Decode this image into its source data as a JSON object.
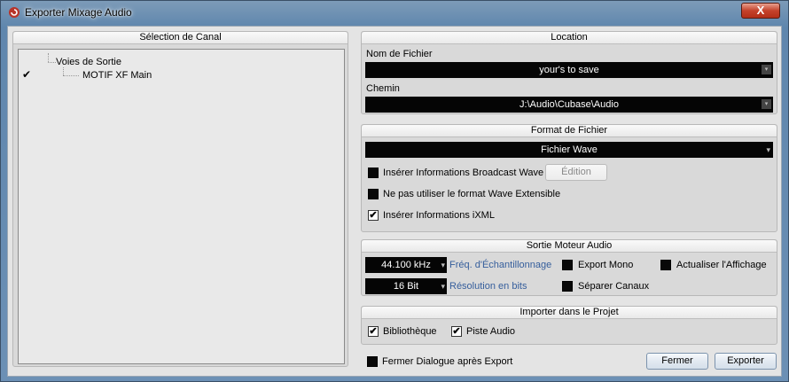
{
  "window": {
    "title": "Exporter Mixage Audio",
    "close_glyph": "X"
  },
  "channel_selection": {
    "header": "Sélection de Canal",
    "tree_root": "Voies de Sortie",
    "tree_child": "MOTIF XF Main",
    "child_checked": true
  },
  "location": {
    "header": "Location",
    "filename_label": "Nom de Fichier",
    "filename_value": "your's to save",
    "path_label": "Chemin",
    "path_value": "J:\\Audio\\Cubase\\Audio"
  },
  "file_format": {
    "header": "Format de Fichier",
    "format_value": "Fichier Wave",
    "broadcast_label": "Insérer Informations Broadcast Wave",
    "broadcast_checked": false,
    "edit_button": "Édition",
    "no_extensible_label": "Ne pas utiliser le format Wave Extensible",
    "no_extensible_checked": false,
    "ixml_label": "Insérer Informations iXML",
    "ixml_checked": true
  },
  "audio_engine": {
    "header": "Sortie Moteur Audio",
    "sample_rate_value": "44.100 kHz",
    "sample_rate_label": "Fréq. d'Échantillonnage",
    "bit_depth_value": "16 Bit",
    "bit_depth_label": "Résolution en bits",
    "export_mono_label": "Export Mono",
    "export_mono_checked": false,
    "split_channels_label": "Séparer Canaux",
    "split_channels_checked": false,
    "update_display_label": "Actualiser l'Affichage",
    "update_display_checked": false
  },
  "import_project": {
    "header": "Importer dans le Projet",
    "library_label": "Bibliothèque",
    "library_checked": true,
    "audio_track_label": "Piste Audio",
    "audio_track_checked": true
  },
  "footer": {
    "close_after_label": "Fermer Dialogue après Export",
    "close_after_checked": false,
    "close_button": "Fermer",
    "export_button": "Exporter"
  },
  "check_glyph": "✔",
  "dropdown_glyph": "▾"
}
